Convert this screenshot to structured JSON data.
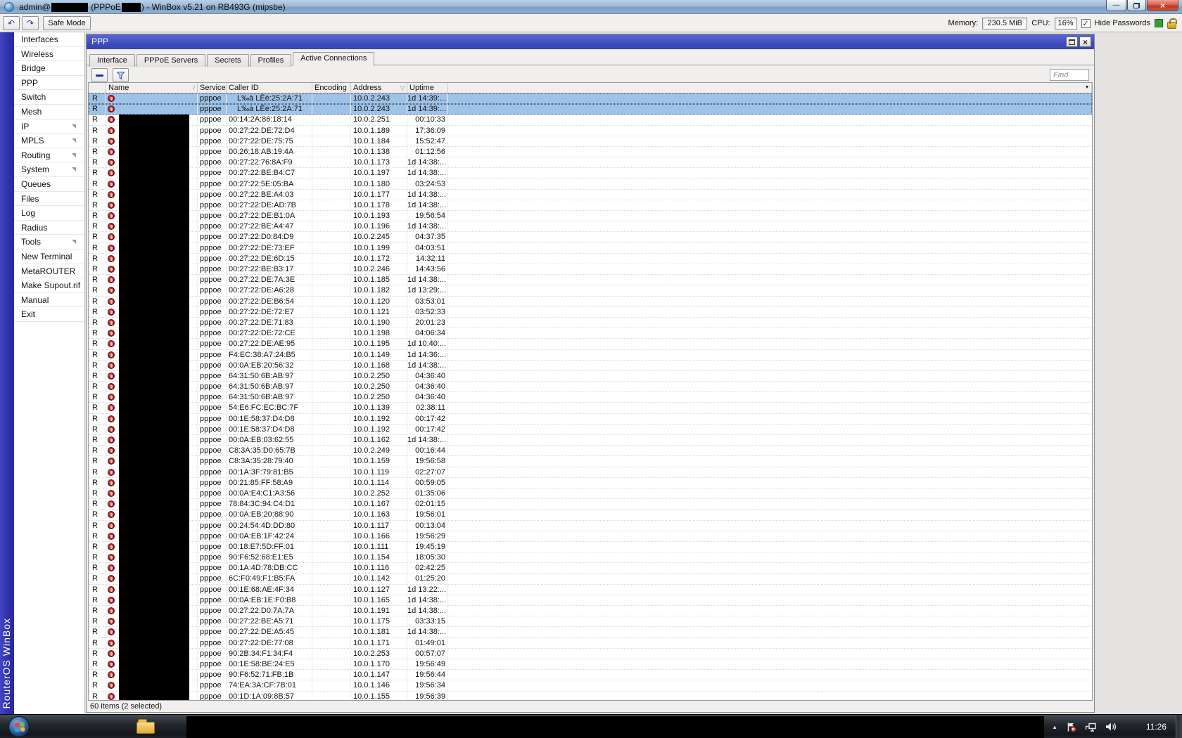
{
  "titlebar": {
    "title_prefix": "admin@",
    "title_mid": " (PPPoE",
    "title_suffix": ") - WinBox v5.21 on RB493G (mipsbe)",
    "minimize_glyph": "—",
    "close_glyph": "×"
  },
  "toolbar": {
    "undo_glyph": "↶",
    "redo_glyph": "↷",
    "safe_mode_label": "Safe Mode",
    "memory_label": "Memory:",
    "memory_value": "230.5 MiB",
    "cpu_label": "CPU:",
    "cpu_value": "16%",
    "hide_passwords_label": "Hide Passwords",
    "hide_passwords_checked": "✓"
  },
  "brand": "RouterOS WinBox",
  "sidebar": {
    "items": [
      {
        "label": "Interfaces",
        "submenu": false
      },
      {
        "label": "Wireless",
        "submenu": false
      },
      {
        "label": "Bridge",
        "submenu": false
      },
      {
        "label": "PPP",
        "submenu": false
      },
      {
        "label": "Switch",
        "submenu": false
      },
      {
        "label": "Mesh",
        "submenu": false
      },
      {
        "label": "IP",
        "submenu": true
      },
      {
        "label": "MPLS",
        "submenu": true
      },
      {
        "label": "Routing",
        "submenu": true
      },
      {
        "label": "System",
        "submenu": true
      },
      {
        "label": "Queues",
        "submenu": false
      },
      {
        "label": "Files",
        "submenu": false
      },
      {
        "label": "Log",
        "submenu": false
      },
      {
        "label": "Radius",
        "submenu": false
      },
      {
        "label": "Tools",
        "submenu": true
      },
      {
        "label": "New Terminal",
        "submenu": false
      },
      {
        "label": "MetaROUTER",
        "submenu": false
      },
      {
        "label": "Make Supout.rif",
        "submenu": false
      },
      {
        "label": "Manual",
        "submenu": false
      },
      {
        "label": "Exit",
        "submenu": false
      }
    ]
  },
  "ppp": {
    "title": "PPP",
    "close_glyph": "×",
    "tabs": [
      "Interface",
      "PPPoE Servers",
      "Secrets",
      "Profiles",
      "Active Connections"
    ],
    "active_tab": 4,
    "find_placeholder": "Find",
    "status": "60 items (2 selected)",
    "table": {
      "columns": {
        "flag": "",
        "name": "Name",
        "service": "Service",
        "caller_id": "Caller ID",
        "encoding": "Encoding",
        "address": "Address",
        "uptime": "Uptime"
      },
      "name_sort_marker": "/",
      "address_filter_marker": "▽",
      "column_button_glyph": "▼",
      "row_flag": "R",
      "row_service": "pppoe",
      "selected_rows": [
        0,
        1
      ],
      "rows": [
        [
          "L‰à  LÊè:25:2A:71",
          "10.0.2.243",
          "1d 14:39:..."
        ],
        [
          "L‰à  LÊè:25:2A:71",
          "10.0.2.243",
          "1d 14:39:..."
        ],
        [
          "00:14:2A:86:18:14",
          "10.0.2.251",
          "00:10:33"
        ],
        [
          "00:27:22:DE:72:D4",
          "10.0.1.189",
          "17:36:09"
        ],
        [
          "00:27:22:DE:75:75",
          "10.0.1.184",
          "15:52:47"
        ],
        [
          "00:26:18:AB:19:4A",
          "10.0.1.138",
          "01:12:56"
        ],
        [
          "00:27:22:76:8A:F9",
          "10.0.1.173",
          "1d 14:38:..."
        ],
        [
          "00:27:22:BE:B4:C7",
          "10.0.1.197",
          "1d 14:38:..."
        ],
        [
          "00:27:22:5E:05:BA",
          "10.0.1.180",
          "03:24:53"
        ],
        [
          "00:27:22:BE:A4:03",
          "10.0.1.177",
          "1d 14:38:..."
        ],
        [
          "00:27:22:DE:AD:7B",
          "10.0.1.178",
          "1d 14:38:..."
        ],
        [
          "00:27:22:DE:B1:0A",
          "10.0.1.193",
          "19:56:54"
        ],
        [
          "00:27:22:BE:A4:47",
          "10.0.1.196",
          "1d 14:38:..."
        ],
        [
          "00:27:22:D0:84:D9",
          "10.0.2.245",
          "04:37:35"
        ],
        [
          "00:27:22:DE:73:EF",
          "10.0.1.199",
          "04:03:51"
        ],
        [
          "00:27:22:DE:6D:15",
          "10.0.1.172",
          "14:32:11"
        ],
        [
          "00:27:22:BE:B3:17",
          "10.0.2.246",
          "14:43:56"
        ],
        [
          "00:27:22:DE:7A:3E",
          "10.0.1.185",
          "1d 14:38:..."
        ],
        [
          "00:27:22:DE:A6:28",
          "10.0.1.182",
          "1d 13:29:..."
        ],
        [
          "00:27:22:DE:B6:54",
          "10.0.1.120",
          "03:53:01"
        ],
        [
          "00:27:22:DE:72:E7",
          "10.0.1.121",
          "03:52:33"
        ],
        [
          "00:27:22:DE:71:83",
          "10.0.1.190",
          "20:01:23"
        ],
        [
          "00:27:22:DE:72:CE",
          "10.0.1.198",
          "04:06:34"
        ],
        [
          "00:27:22:DE:AE:95",
          "10.0.1.195",
          "1d 10:40:..."
        ],
        [
          "F4:EC:38:A7:24:B5",
          "10.0.1.149",
          "1d 14:36:..."
        ],
        [
          "00:0A:EB:20:56:32",
          "10.0.1.168",
          "1d 14:38:..."
        ],
        [
          "64:31:50:6B:AB:97",
          "10.0.2.250",
          "04:36:40"
        ],
        [
          "64:31:50:6B:AB:97",
          "10.0.2.250",
          "04:36:40"
        ],
        [
          "64:31:50:6B:AB:97",
          "10.0.2.250",
          "04:36:40"
        ],
        [
          "54:E6:FC:EC:BC:7F",
          "10.0.1.139",
          "02:38:11"
        ],
        [
          "00:1E:58:37:D4:D8",
          "10.0.1.192",
          "00:17:42"
        ],
        [
          "00:1E:58:37:D4:D8",
          "10.0.1.192",
          "00:17:42"
        ],
        [
          "00:0A:EB:03:62:55",
          "10.0.1.162",
          "1d 14:38:..."
        ],
        [
          "C8:3A:35:D0:65:7B",
          "10.0.2.249",
          "00:16:44"
        ],
        [
          "C8:3A:35:28:79:40",
          "10.0.1.159",
          "19:56:58"
        ],
        [
          "00:1A:3F:79:81:B5",
          "10.0.1.119",
          "02:27:07"
        ],
        [
          "00:21:85:FF:58:A9",
          "10.0.1.114",
          "00:59:05"
        ],
        [
          "00:0A:E4:C1:A3:56",
          "10.0.2.252",
          "01:35:06"
        ],
        [
          "78:84:3C:94:C4:D1",
          "10.0.1.167",
          "02:01:15"
        ],
        [
          "00:0A:EB:20:88:90",
          "10.0.1.163",
          "19:56:01"
        ],
        [
          "00:24:54:4D:DD:80",
          "10.0.1.117",
          "00:13:04"
        ],
        [
          "00:0A:EB:1F:42:24",
          "10.0.1.166",
          "19:56:29"
        ],
        [
          "00:18:E7:5D:FF:01",
          "10.0.1.111",
          "19:45:19"
        ],
        [
          "90:F6:52:68:E1:E5",
          "10.0.1.154",
          "18:05:30"
        ],
        [
          "00:1A:4D:78:DB:CC",
          "10.0.1.116",
          "02:42:25"
        ],
        [
          "6C:F0:49:F1:B5:FA",
          "10.0.1.142",
          "01:25:20"
        ],
        [
          "00:1E:68:AE:4F:34",
          "10.0.1.127",
          "1d 13:22:..."
        ],
        [
          "00:0A:EB:1E:F0:B8",
          "10.0.1.165",
          "1d 14:38:..."
        ],
        [
          "00:27:22:D0:7A:7A",
          "10.0.1.191",
          "1d 14:38:..."
        ],
        [
          "00:27:22:BE:A5:71",
          "10.0.1.175",
          "03:33:15"
        ],
        [
          "00:27:22:DE:A5:45",
          "10.0.1.181",
          "1d 14:38:..."
        ],
        [
          "00:27:22:DE:77:08",
          "10.0.1.171",
          "01:49:01"
        ],
        [
          "90:2B:34:F1:34:F4",
          "10.0.2.253",
          "00:57:07"
        ],
        [
          "00:1E:58:BE:24:E5",
          "10.0.1.170",
          "19:56:49"
        ],
        [
          "90:F6:52:71:FB:1B",
          "10.0.1.147",
          "19:56:44"
        ],
        [
          "74:EA:3A:CF:7B:01",
          "10.0.1.146",
          "19:56:34"
        ],
        [
          "00:1D:1A:09:8B:57",
          "10.0.1.155",
          "19:56:39"
        ]
      ]
    }
  },
  "taskbar": {
    "time": "11:26",
    "tray_arrow": "▲"
  }
}
